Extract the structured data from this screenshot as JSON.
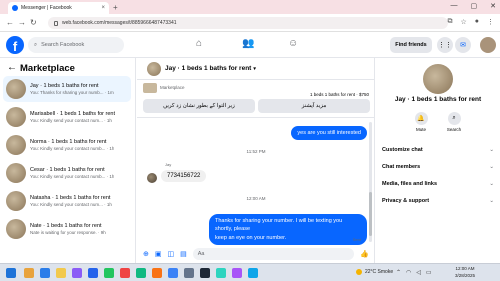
{
  "browser": {
    "tab_title": "Messenger | Facebook",
    "url": "web.facebook.com/messages/t/8859666487473341",
    "tab_close": "×",
    "new_tab": "+",
    "window_controls": [
      "—",
      "▢",
      "✕"
    ]
  },
  "fb_nav": {
    "search_placeholder": "Search Facebook",
    "find_friends_label": "Find friends"
  },
  "sidebar": {
    "title": "Marketplace",
    "conversations": [
      {
        "name": "Jay · 1 beds 1 baths for rent",
        "preview": "You: Thanks for sharing your numb... · 1m",
        "active": true
      },
      {
        "name": "Marisabell · 1 beds 1 baths for rent",
        "preview": "You: Kindly send your contact num... · 1h"
      },
      {
        "name": "Norma · 1 beds 1 baths for rent",
        "preview": "You: Kindly send your contact numb... · 1h"
      },
      {
        "name": "Cesar · 1 beds 1 baths for rent",
        "preview": "You: Kindly send your contact numb... · 1h"
      },
      {
        "name": "Natasha · 1 beds 1 baths for rent",
        "preview": "You: Kindly send your contact num... · 1h"
      },
      {
        "name": "Nate · 1 beds 1 baths for rent",
        "preview": "Nate is waiting for your response. · 9h"
      }
    ]
  },
  "chat": {
    "title": "Jay · 1 beds 1 baths for rent",
    "listing": {
      "label": "Marketplace",
      "title": "1 beds 1 baths for rent · $750",
      "button_left": "زیر التوا کے بطور نشان زد کریں",
      "button_right": "مزید آپشنز"
    },
    "messages": {
      "out_1": "yes are you still interested",
      "time_1": "11:52 PM",
      "sender": "Jay",
      "in_1": "7734156722",
      "time_2": "12:00 AM",
      "out_2_line1": "Thanks for sharing your number. I will be texting you shortly, please",
      "out_2_line2": "keep an eye on your number.",
      "status": "Sent"
    },
    "composer_placeholder": "Aa"
  },
  "details": {
    "title": "Jay · 1 beds 1 baths for rent",
    "mute_label": "Mute",
    "search_label": "Search",
    "sections": [
      "Customize chat",
      "Chat members",
      "Media, files and links",
      "Privacy & support"
    ]
  },
  "taskbar": {
    "weather": "22°C  Smoke",
    "time": "12:00 AM",
    "date": "3/28/2025"
  }
}
